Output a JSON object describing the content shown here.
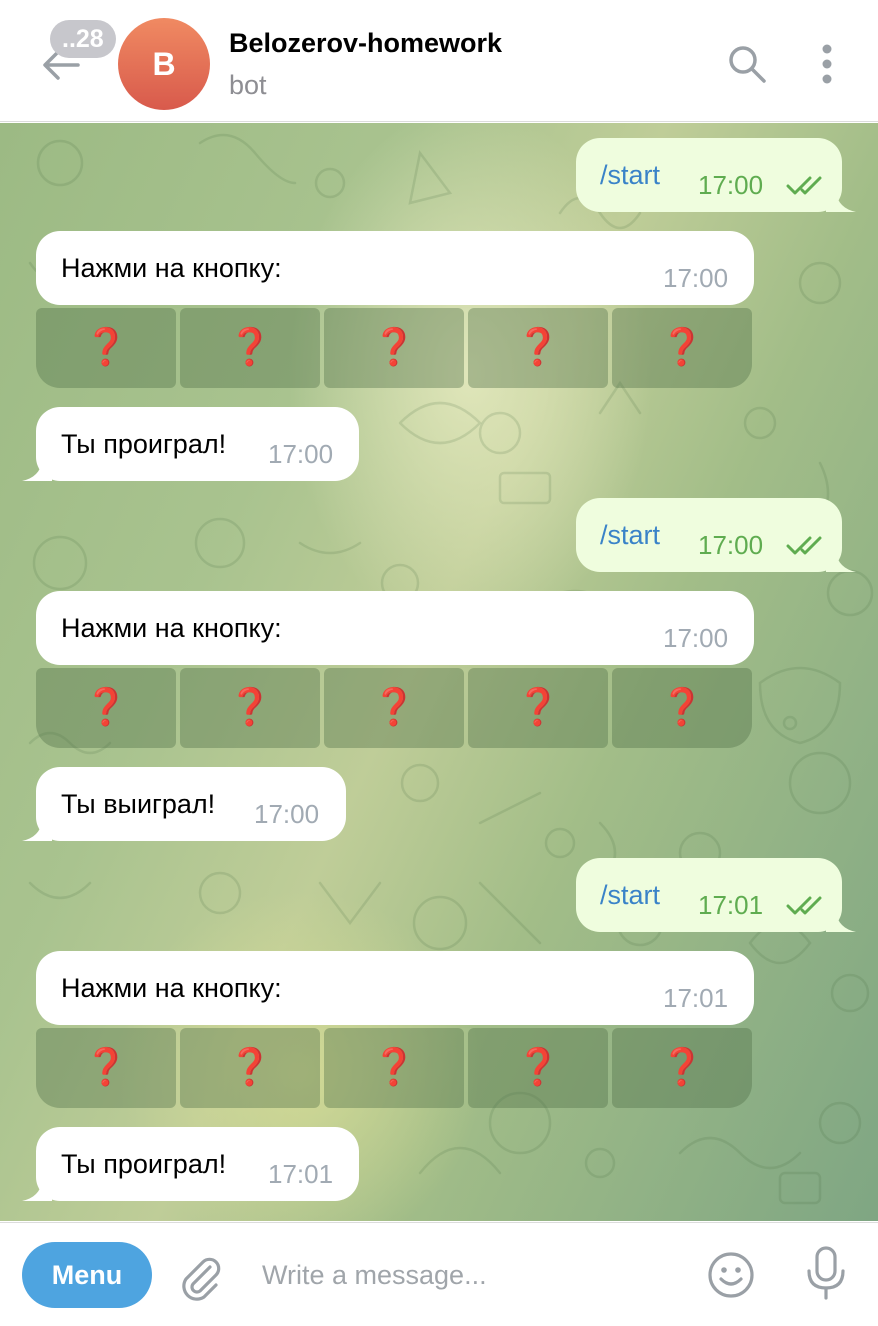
{
  "header": {
    "unread_badge": "..28",
    "avatar_letter": "B",
    "chat_title": "Belozerov-homework",
    "chat_subtitle": "bot"
  },
  "messages": [
    {
      "type": "outgoing",
      "text": "/start",
      "time": "17:00",
      "status": "read"
    },
    {
      "type": "incoming",
      "text": "Нажми на кнопку:",
      "time": "17:00",
      "buttons": [
        "❓",
        "❓",
        "❓",
        "❓",
        "❓"
      ]
    },
    {
      "type": "incoming",
      "text": "Ты проиграл!",
      "time": "17:00"
    },
    {
      "type": "outgoing",
      "text": "/start",
      "time": "17:00",
      "status": "read"
    },
    {
      "type": "incoming",
      "text": "Нажми на кнопку:",
      "time": "17:00",
      "buttons": [
        "❓",
        "❓",
        "❓",
        "❓",
        "❓"
      ]
    },
    {
      "type": "incoming",
      "text": "Ты выиграл!",
      "time": "17:00"
    },
    {
      "type": "outgoing",
      "text": "/start",
      "time": "17:01",
      "status": "read"
    },
    {
      "type": "incoming",
      "text": "Нажми на кнопку:",
      "time": "17:01",
      "buttons": [
        "❓",
        "❓",
        "❓",
        "❓",
        "❓"
      ]
    },
    {
      "type": "incoming",
      "text": "Ты проиграл!",
      "time": "17:01"
    }
  ],
  "composer": {
    "menu_label": "Menu",
    "placeholder": "Write a message..."
  },
  "icons": {
    "back": "back-arrow-icon",
    "search": "search-icon",
    "more": "more-vertical-icon",
    "attach": "paperclip-icon",
    "emoji": "emoji-icon",
    "mic": "microphone-icon",
    "read_status": "double-check-icon"
  },
  "colors": {
    "accent": "#4ea4e0",
    "outgoing_bubble": "#effdde",
    "incoming_bubble": "#ffffff",
    "command_text": "#3a83c8",
    "outgoing_time": "#5fac50",
    "avatar": "#e06c54",
    "question_mark": "#d6282b"
  }
}
